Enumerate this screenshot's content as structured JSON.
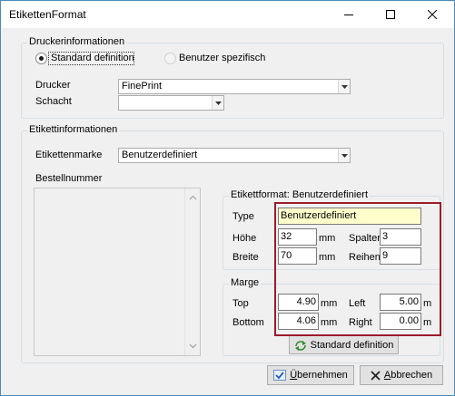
{
  "window": {
    "title": "EtikettenFormat"
  },
  "druckerinformationen": {
    "legend": "Druckerinformationen",
    "radio_standard": "Standard definition",
    "radio_benutzer": "Benutzer spezifisch",
    "drucker_label": "Drucker",
    "drucker_value": "FinePrint",
    "schacht_label": "Schacht",
    "schacht_value": ""
  },
  "etikettinformationen": {
    "legend": "Etikettinformationen",
    "marke_label": "Etikettenmarke",
    "marke_value": "Benutzerdefiniert",
    "bestellnummer_label": "Bestellnummer"
  },
  "etikettformat": {
    "legend": "Etikettformat: Benutzerdefiniert",
    "typ_label": "Type",
    "typ_value": "Benutzerdefiniert",
    "hoehe_label": "Höhe",
    "hoehe_value": "32",
    "hoehe_unit": "mm",
    "spalten_label": "Spalter",
    "spalten_value": "3",
    "breite_label": "Breite",
    "breite_value": "70",
    "breite_unit": "mm",
    "reihen_label": "Reihen",
    "reihen_value": "9"
  },
  "marge": {
    "legend": "Marge",
    "top_label": "Top",
    "top_value": "4.90",
    "top_unit": "mm",
    "left_label": "Left",
    "left_value": "5.00",
    "left_unit": "m",
    "bottom_label": "Bottom",
    "bottom_value": "4.06",
    "bottom_unit": "mm",
    "right_label": "Right",
    "right_value": "0.00",
    "right_unit": "m"
  },
  "buttons": {
    "standard_definition": "Standard definition",
    "uebernehmen_u": "Ü",
    "uebernehmen_rest": "bernehmen",
    "abbrechen_u": "A",
    "abbrechen_rest": "bbrechen"
  },
  "colors": {
    "highlight_frame": "#9c1b2a",
    "window_border": "#4a8ac0",
    "dialog_bg": "#f0f0f0"
  },
  "icons": [
    "minimize-icon",
    "maximize-icon",
    "close-icon",
    "dropdown-arrow-icon",
    "refresh-icon",
    "checkmark-icon",
    "x-cross-icon",
    "scroll-up-icon",
    "scroll-down-icon"
  ]
}
